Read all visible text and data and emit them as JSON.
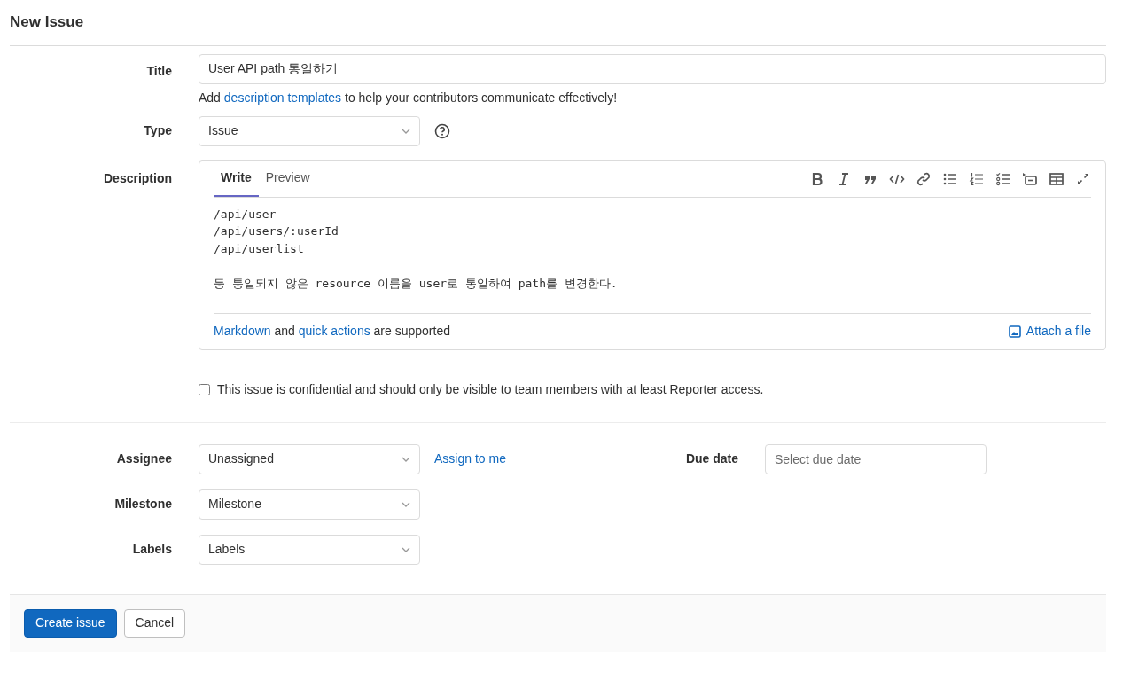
{
  "page_title": "New Issue",
  "title_field": {
    "label": "Title",
    "value": "User API path 통일하기"
  },
  "template_hint": {
    "before": "Add ",
    "link": "description templates",
    "after": " to help your contributors communicate effectively!"
  },
  "type_field": {
    "label": "Type",
    "value": "Issue"
  },
  "description": {
    "label": "Description",
    "tabs": [
      {
        "label": "Write",
        "selected": true
      },
      {
        "label": "Preview",
        "selected": false
      }
    ],
    "value": "/api/user\n/api/users/:userId\n/api/userlist\n\n등 통일되지 않은 resource 이름을 user로 통일하여 path를 변경한다.",
    "footer": {
      "link1": "Markdown",
      "middle": " and ",
      "link2": "quick actions",
      "after": " are supported"
    },
    "attach": "Attach a file"
  },
  "confidential": {
    "label": "This issue is confidential and should only be visible to team members with at least Reporter access.",
    "checked": false
  },
  "assignee": {
    "label": "Assignee",
    "value": "Unassigned",
    "action": "Assign to me"
  },
  "due_date": {
    "label": "Due date",
    "placeholder": "Select due date"
  },
  "milestone": {
    "label": "Milestone",
    "value": "Milestone"
  },
  "labels": {
    "label": "Labels",
    "value": "Labels"
  },
  "buttons": [
    {
      "label": "Create issue",
      "kind": "primary"
    },
    {
      "label": "Cancel",
      "kind": "secondary"
    }
  ]
}
